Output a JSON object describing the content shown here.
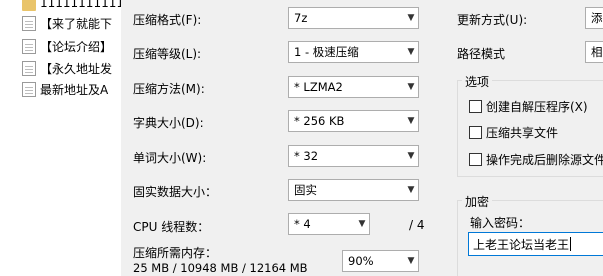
{
  "file_list": [
    {
      "icon": "folder-icon",
      "name": "11111111111"
    },
    {
      "icon": "doc-icon",
      "name": "【来了就能下"
    },
    {
      "icon": "doc-icon",
      "name": "【论坛介绍】"
    },
    {
      "icon": "doc-icon",
      "name": "【永久地址发"
    },
    {
      "icon": "doc-icon",
      "name": "最新地址及A"
    }
  ],
  "settings": {
    "format": {
      "label": "压缩格式(F):",
      "value": "7z"
    },
    "level": {
      "label": "压缩等级(L):",
      "value": "1 - 极速压缩"
    },
    "method": {
      "label": "压缩方法(M):",
      "value": "* LZMA2"
    },
    "dict": {
      "label": "字典大小(D):",
      "value": "* 256 KB"
    },
    "word": {
      "label": "单词大小(W):",
      "value": "* 32"
    },
    "solid": {
      "label": "固实数据大小：",
      "value": "固实"
    },
    "cpu": {
      "label": "CPU 线程数：",
      "value": "* 4",
      "total": "/ 4"
    },
    "memory": {
      "label": "压缩所需内存：",
      "detail": "25 MB / 10948 MB / 12164 MB",
      "value": "90%"
    }
  },
  "update": {
    "label": "更新方式(U):",
    "value": "添"
  },
  "path": {
    "label": "路径模式",
    "value": "相"
  },
  "options": {
    "title": "选项",
    "items": [
      {
        "label": "创建自解压程序(X)",
        "checked": false
      },
      {
        "label": "压缩共享文件",
        "checked": false
      },
      {
        "label": "操作完成后删除源文件",
        "checked": false
      }
    ]
  },
  "encryption": {
    "title": "加密",
    "pw_label": "输入密码：",
    "pw_value": "上老王论坛当老王"
  }
}
